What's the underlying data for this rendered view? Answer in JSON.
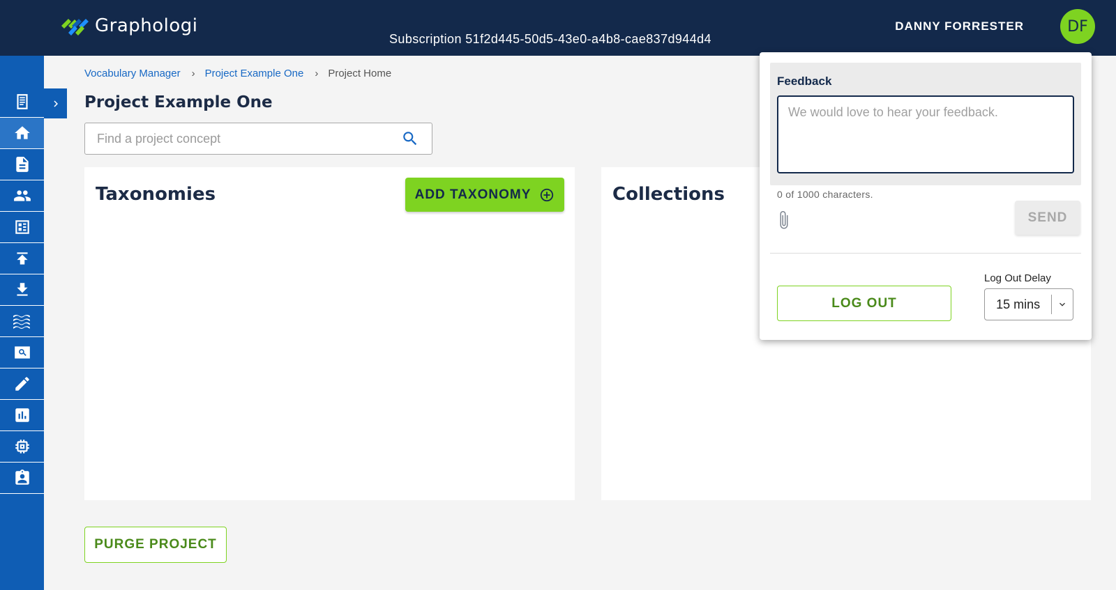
{
  "app": {
    "name": "Graphologi",
    "subscription": "Subscription 51f2d445-50d5-43e0-a4b8-cae837d944d4"
  },
  "user": {
    "name": "DANNY FORRESTER",
    "initials": "DF"
  },
  "colors": {
    "topbar": "#13294b",
    "sidebar": "#0f5db4",
    "accent": "#7ed321",
    "link": "#1768c4"
  },
  "sidebar": {
    "items": [
      {
        "icon": "page-icon"
      },
      {
        "icon": "home-icon",
        "active": true
      },
      {
        "icon": "document-icon"
      },
      {
        "icon": "people-icon"
      },
      {
        "icon": "dashboard-icon"
      },
      {
        "icon": "upload-icon"
      },
      {
        "icon": "download-icon"
      },
      {
        "icon": "waves-icon"
      },
      {
        "icon": "search-image-icon"
      },
      {
        "icon": "pencil-icon"
      },
      {
        "icon": "chart-icon"
      },
      {
        "icon": "chip-icon"
      },
      {
        "icon": "badge-icon"
      }
    ],
    "expand_icon": "chevron-right-icon"
  },
  "breadcrumb": {
    "items": [
      "Vocabulary Manager",
      "Project Example One"
    ],
    "current": "Project Home",
    "separator": "›"
  },
  "page": {
    "title": "Project Example One",
    "search_placeholder": "Find a project concept"
  },
  "taxonomies": {
    "title": "Taxonomies",
    "add_label": "ADD TAXONOMY"
  },
  "collections": {
    "title": "Collections"
  },
  "purge_label": "PURGE PROJECT",
  "feedback": {
    "label": "Feedback",
    "placeholder": "We would love to hear your feedback.",
    "value": "",
    "count_text": "0 of 1000 characters.",
    "send_label": "SEND",
    "logout_label": "LOG OUT",
    "delay_label": "Log Out Delay",
    "delay_value": "15 mins"
  }
}
